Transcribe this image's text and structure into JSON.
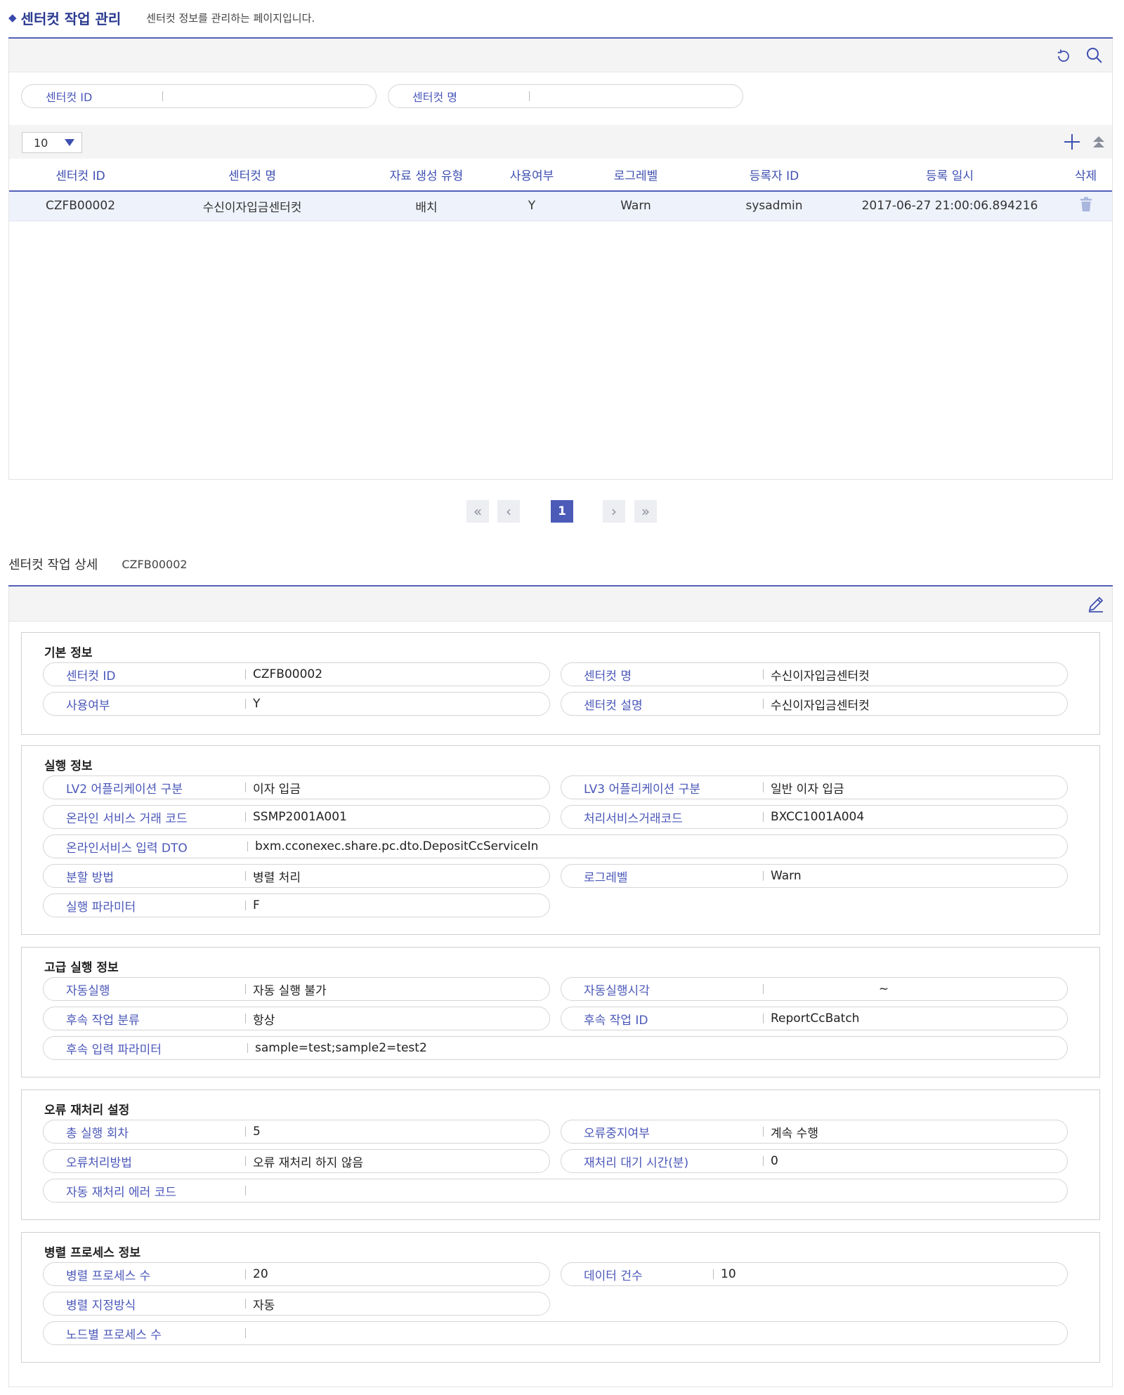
{
  "header": {
    "title": "센터컷 작업 관리",
    "description": "센터컷 정보를 관리하는 페이지입니다."
  },
  "search": {
    "fields": [
      {
        "label": "센터컷 ID",
        "value": ""
      },
      {
        "label": "센터컷 명",
        "value": ""
      }
    ]
  },
  "grid": {
    "page_size": "10",
    "columns": [
      "센터컷 ID",
      "센터컷 명",
      "자료 생성 유형",
      "사용여부",
      "로그레벨",
      "등록자 ID",
      "등록 일시",
      "삭제"
    ],
    "rows": [
      {
        "id": "CZFB00002",
        "name": "수신이자입금센터컷",
        "type": "배치",
        "use": "Y",
        "log": "Warn",
        "user": "sysadmin",
        "date": "2017-06-27 21:00:06.894216"
      }
    ]
  },
  "pager": {
    "first": "«",
    "prev": "‹",
    "current": "1",
    "next": "›",
    "last": "»"
  },
  "detail": {
    "title": "센터컷 작업 상세",
    "id": "CZFB00002",
    "sections": [
      {
        "title": "기본 정보",
        "fields": [
          {
            "label": "센터컷 ID",
            "value": "CZFB00002"
          },
          {
            "label": "센터컷 명",
            "value": "수신이자입금센터컷"
          },
          {
            "label": "사용여부",
            "value": "Y"
          },
          {
            "label": "센터컷 설명",
            "value": "수신이자입금센터컷"
          }
        ]
      },
      {
        "title": "실행 정보",
        "fields": [
          {
            "label": "LV2 어플리케이션 구분",
            "value": "이자 입금"
          },
          {
            "label": "LV3 어플리케이션 구분",
            "value": "일반 이자 입금"
          },
          {
            "label": "온라인 서비스 거래 코드",
            "value": "SSMP2001A001"
          },
          {
            "label": "처리서비스거래코드",
            "value": "BXCC1001A004"
          },
          {
            "label": "온라인서비스 입력 DTO",
            "value": "bxm.cconexec.share.pc.dto.DepositCcServiceIn"
          },
          {
            "label": "분할 방법",
            "value": "병렬 처리"
          },
          {
            "label": "로그레벨",
            "value": "Warn"
          },
          {
            "label": "실행 파라미터",
            "value": "F"
          }
        ]
      },
      {
        "title": "고급 실행 정보",
        "fields": [
          {
            "label": "자동실행",
            "value": "자동 실행 불가"
          },
          {
            "label": "자동실행시각",
            "value": "~"
          },
          {
            "label": "후속 작업 분류",
            "value": "항상"
          },
          {
            "label": "후속 작업 ID",
            "value": "ReportCcBatch"
          },
          {
            "label": "후속 입력 파라미터",
            "value": "sample=test;sample2=test2"
          }
        ]
      },
      {
        "title": "오류 재처리 설정",
        "fields": [
          {
            "label": "총 실행 회차",
            "value": "5"
          },
          {
            "label": "오류중지여부",
            "value": "계속 수행"
          },
          {
            "label": "오류처리방법",
            "value": "오류 재처리 하지 않음"
          },
          {
            "label": "재처리 대기 시간(분)",
            "value": "0"
          },
          {
            "label": "자동 재처리 에러 코드",
            "value": ""
          }
        ]
      },
      {
        "title": "병렬 프로세스 정보",
        "fields": [
          {
            "label": "병렬 프로세스 수",
            "value": "20"
          },
          {
            "label": "데이터 건수",
            "value": "10"
          },
          {
            "label": "병렬 지정방식",
            "value": "자동"
          },
          {
            "label": "노드별 프로세스 수",
            "value": ""
          }
        ]
      }
    ]
  },
  "icons": {
    "refresh": "refresh-icon",
    "search": "search-icon",
    "add": "plus-icon",
    "collapse": "collapse-up-icon",
    "delete": "trash-icon",
    "edit": "pencil-icon"
  },
  "colors": {
    "accent": "#3e4fb0",
    "rule": "#5360b5",
    "selected_row": "#eef2fb",
    "active_page": "#4c5bb8"
  }
}
